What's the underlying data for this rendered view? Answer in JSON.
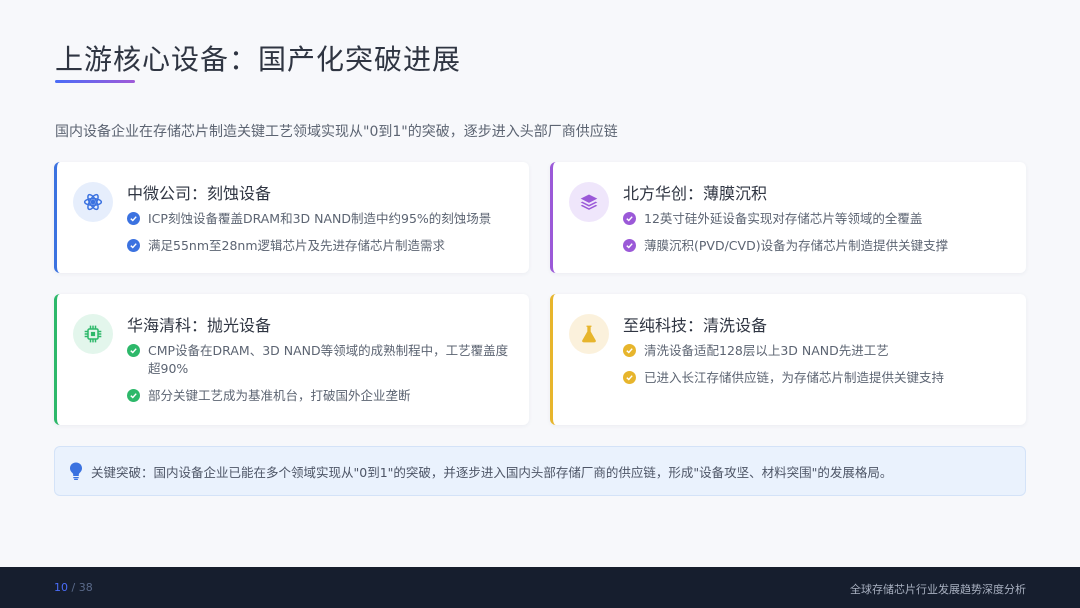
{
  "header": {
    "title": "上游核心设备：国产化突破进展",
    "subtitle": "国内设备企业在存储芯片制造关键工艺领域实现从\"0到1\"的突破，逐步进入头部厂商供应链"
  },
  "cards": [
    {
      "title": "中微公司：刻蚀设备",
      "icon": "atom-icon",
      "color": "#3b72e0",
      "items": [
        "ICP刻蚀设备覆盖DRAM和3D NAND制造中约95%的刻蚀场景",
        "满足55nm至28nm逻辑芯片及先进存储芯片制造需求"
      ]
    },
    {
      "title": "北方华创：薄膜沉积",
      "icon": "layers-icon",
      "color": "#9b59d8",
      "items": [
        "12英寸硅外延设备实现对存储芯片等领域的全覆盖",
        "薄膜沉积(PVD/CVD)设备为存储芯片制造提供关键支撑"
      ]
    },
    {
      "title": "华海清科：抛光设备",
      "icon": "chip-icon",
      "color": "#2db86a",
      "items": [
        "CMP设备在DRAM、3D NAND等领域的成熟制程中，工艺覆盖度超90%",
        "部分关键工艺成为基准机台，打破国外企业垄断"
      ]
    },
    {
      "title": "至纯科技：清洗设备",
      "icon": "flask-icon",
      "color": "#e7b52c",
      "items": [
        "清洗设备适配128层以上3D NAND先进工艺",
        "已进入长江存储供应链，为存储芯片制造提供关键支持"
      ]
    }
  ],
  "note": {
    "icon": "lightbulb-icon",
    "text": "关键突破：国内设备企业已能在多个领域实现从\"0到1\"的突破，并逐步进入国内头部存储厂商的供应链，形成\"设备攻坚、材料突围\"的发展格局。"
  },
  "footer": {
    "page_current": "10",
    "page_total": "/ 38",
    "right_text": "全球存储芯片行业发展趋势深度分析"
  }
}
